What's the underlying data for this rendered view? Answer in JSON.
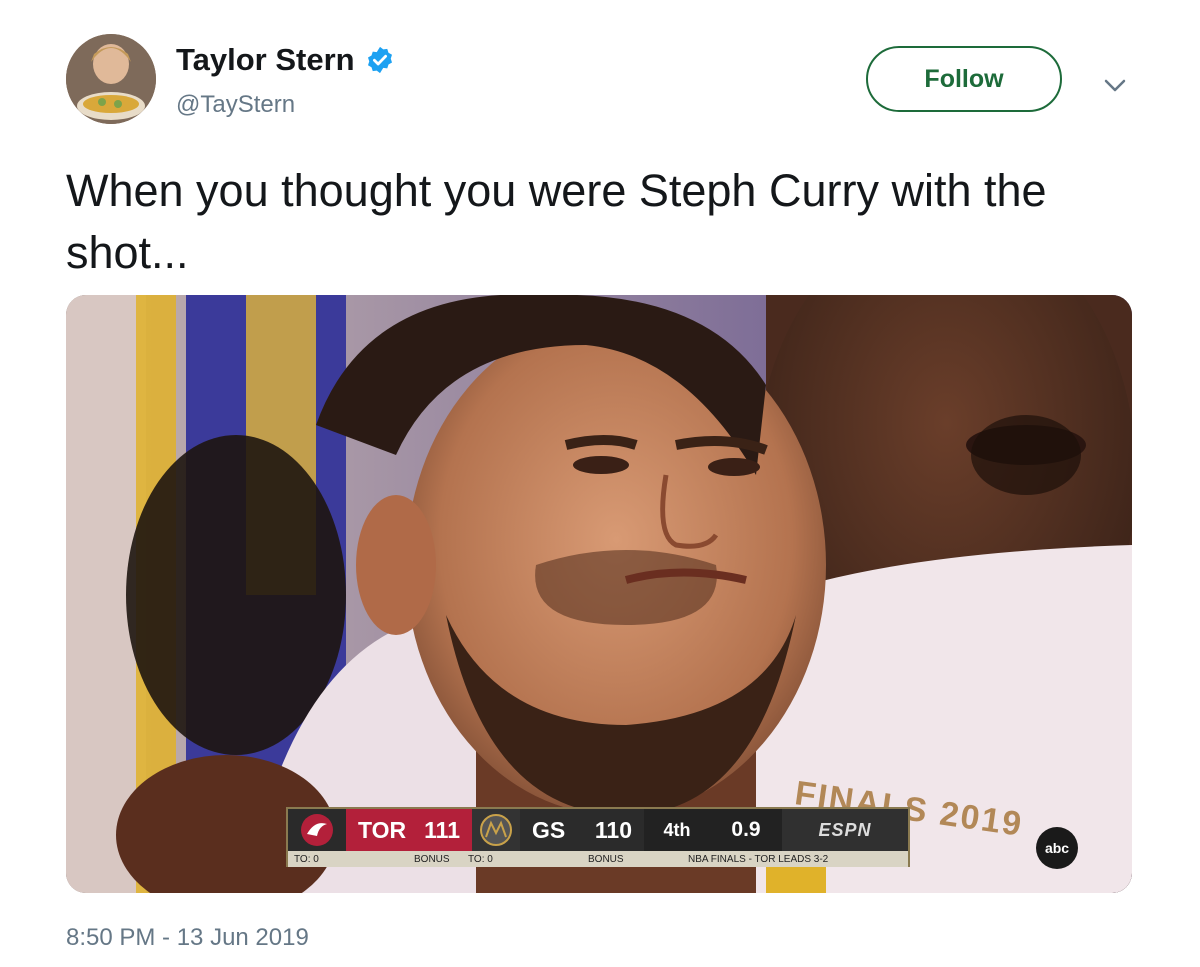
{
  "author": {
    "name": "Taylor Stern",
    "handle": "@TayStern",
    "verified_icon": "verified-badge-icon",
    "verified_color": "#1da1f2"
  },
  "actions": {
    "follow_label": "Follow",
    "more_icon": "chevron-down-icon"
  },
  "tweet": {
    "text": "When you thought you were Steph Curry with the shot...",
    "timestamp": "8:50 PM - 13 Jun 2019"
  },
  "media": {
    "scoreboard": {
      "team1_abbr": "TOR",
      "team1_score": "111",
      "team2_abbr": "GS",
      "team2_score": "110",
      "quarter": "4th",
      "clock": "0.9",
      "network": "ESPN",
      "team1_timeouts": "TO: 0",
      "team1_bonus": "BONUS",
      "team2_timeouts": "TO: 0",
      "team2_bonus": "BONUS",
      "series_note": "NBA FINALS - TOR LEADS 3-2",
      "team1_color": "#b3203a"
    },
    "shirt_text": "FINALS 2019",
    "broadcaster_bug": "abc"
  }
}
